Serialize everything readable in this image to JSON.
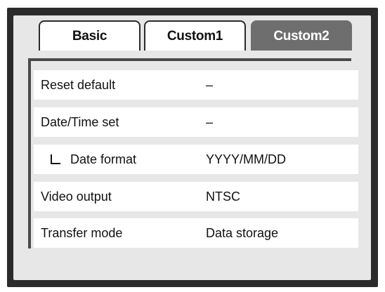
{
  "tabs": [
    {
      "label": "Basic",
      "active": false
    },
    {
      "label": "Custom1",
      "active": false
    },
    {
      "label": "Custom2",
      "active": true
    }
  ],
  "settings": [
    {
      "label": "Reset default",
      "value": "–"
    },
    {
      "label": "Date/Time set",
      "value": "–"
    },
    {
      "label": "Date format",
      "value": "YYYY/MM/DD",
      "sub_item": true,
      "icon": "sub-item-corner-icon"
    },
    {
      "label": "Video output",
      "value": "NTSC"
    },
    {
      "label": "Transfer mode",
      "value": "Data storage"
    }
  ],
  "colors": {
    "frame": "#2b2b2b",
    "panel": "#e7e7e7",
    "active_tab": "#6e6e6e",
    "row_bg": "#ffffff"
  }
}
